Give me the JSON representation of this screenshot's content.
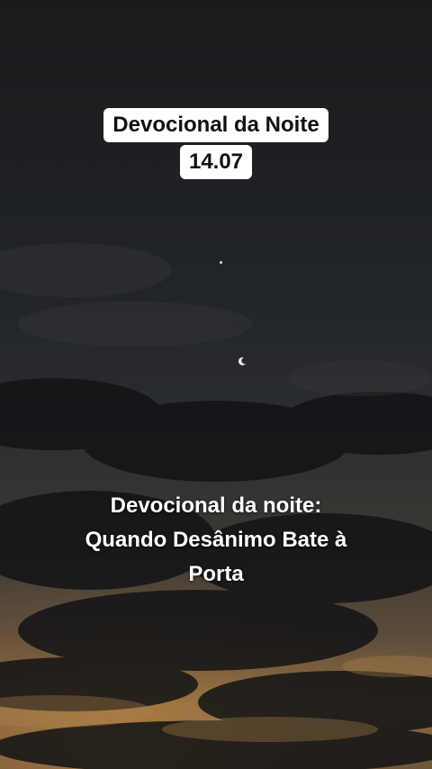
{
  "header": {
    "title_line1": "Devocional da Noite",
    "title_line2": "14.07"
  },
  "caption": {
    "line1": "Devocional da noite:",
    "line2": "Quando Desânimo Bate à",
    "line3": "Porta"
  },
  "colors": {
    "pill_background": "#ffffff",
    "pill_text": "#111111",
    "caption_text": "#ffffff",
    "sunset_glow": "#d6964a"
  }
}
